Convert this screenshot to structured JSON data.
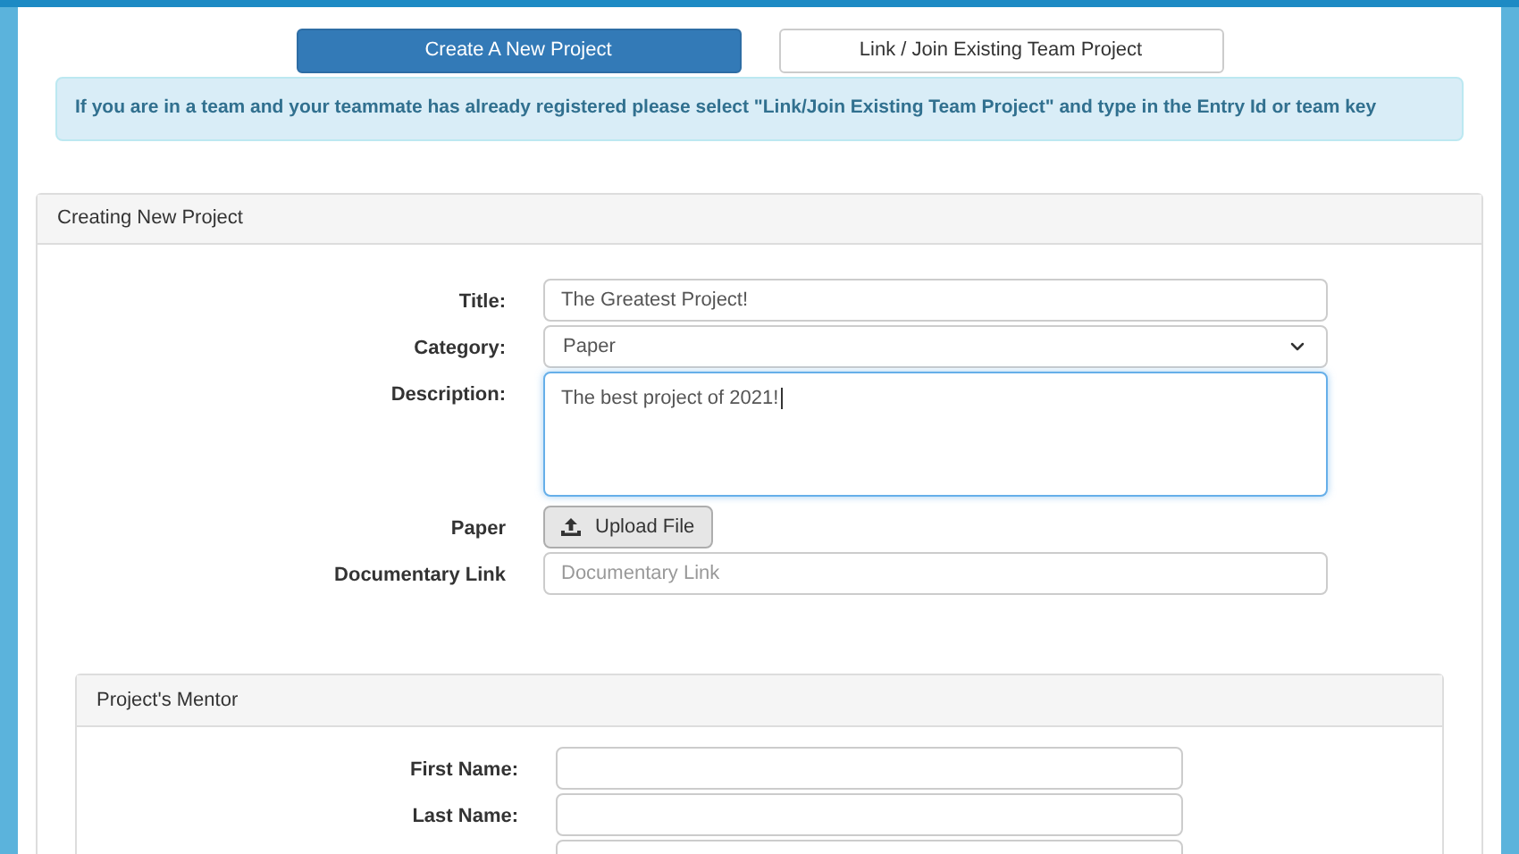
{
  "tabs": [
    {
      "label": "Create A New Project",
      "selected": true
    },
    {
      "label": "Link / Join Existing Team Project",
      "selected": false
    }
  ],
  "alert": "If you are in a team and your teammate has already registered please select \"Link/Join Existing Team Project\" and type in the Entry Id or team key",
  "project_panel": {
    "title": "Creating New Project",
    "fields": [
      {
        "kind": "text",
        "label": "Title:",
        "value": "The Greatest Project!"
      },
      {
        "kind": "select",
        "label": "Category:",
        "value": "Paper"
      },
      {
        "kind": "textarea",
        "label": "Description:",
        "value": "The best project of 2021!",
        "focused": true
      },
      {
        "kind": "upload",
        "label": "Paper",
        "button": "Upload File"
      },
      {
        "kind": "text",
        "label": "Documentary Link",
        "placeholder": "Documentary Link"
      }
    ]
  },
  "mentor_panel": {
    "title": "Project's Mentor",
    "fields": [
      {
        "kind": "text",
        "label": "First Name:"
      },
      {
        "kind": "text",
        "label": "Last Name:"
      },
      {
        "kind": "text"
      }
    ]
  }
}
